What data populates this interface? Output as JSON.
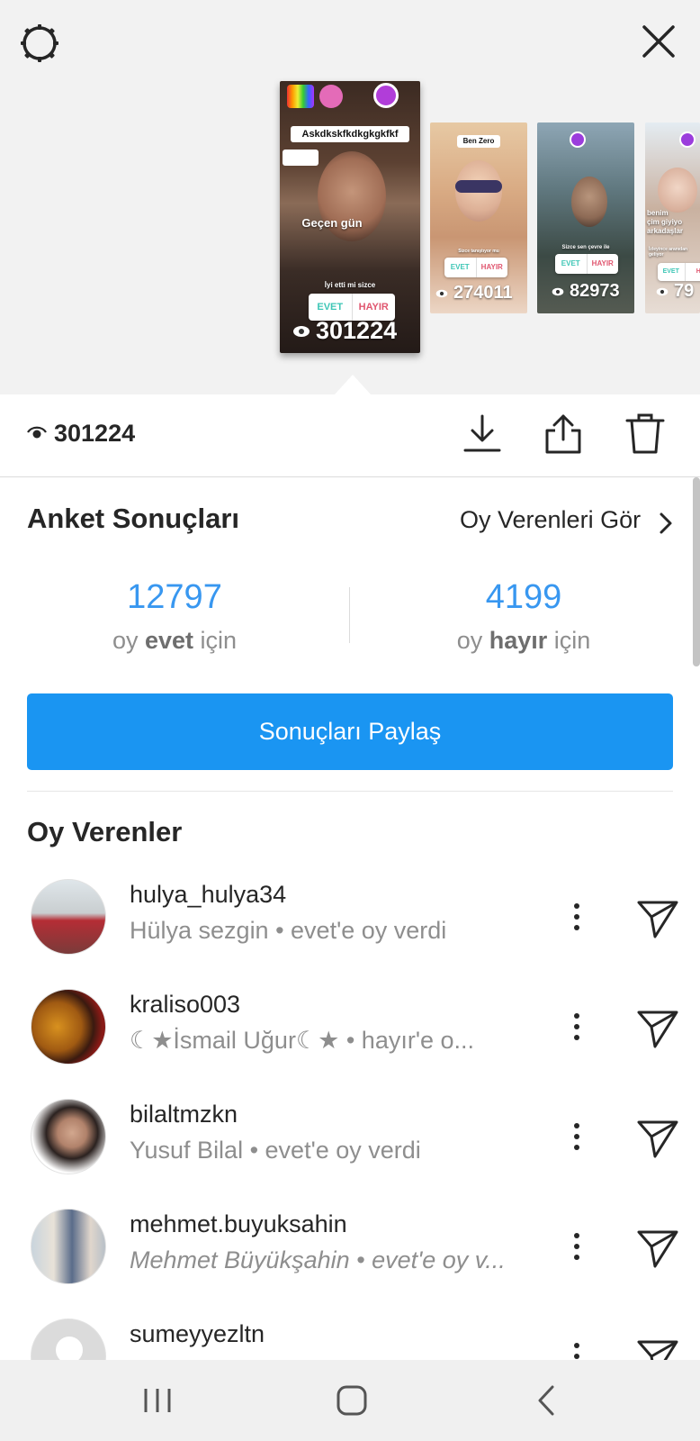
{
  "top": {
    "stories": [
      {
        "views": "301224",
        "caption_top": "Askdkskfkdkgkgkfkf",
        "text_mid": "Geçen gün",
        "question": "İyi etti mi sizce",
        "yes": "EVET",
        "no": "HAYIR"
      },
      {
        "views": "274011",
        "caption_top": "Ben Zero",
        "question": "Sizce tanıştıyor mu",
        "yes": "EVET",
        "no": "HAYIR"
      },
      {
        "views": "82973",
        "question": "Sizce sen çevre ile",
        "yes": "EVET",
        "no": "HAYIR"
      },
      {
        "views": "79",
        "text_mid": "benim\nçim giyiyo\narkadaşlar",
        "question": "İzleyince aranıdan\ngeliyor",
        "yes": "EVET",
        "no": "H"
      }
    ]
  },
  "views_bar": {
    "count": "301224"
  },
  "poll": {
    "title": "Anket Sonuçları",
    "see_voters": "Oy Verenleri Gör",
    "yes": {
      "count": "12797",
      "prefix": "oy ",
      "word": "evet",
      "suffix": " için"
    },
    "no": {
      "count": "4199",
      "prefix": "oy ",
      "word": "hayır",
      "suffix": " için"
    },
    "share": "Sonuçları Paylaş"
  },
  "voters": {
    "title": "Oy Verenler",
    "items": [
      {
        "username": "hulya_hulya34",
        "subtitle": "Hülya sezgin • evet'e oy verdi"
      },
      {
        "username": "kraliso003",
        "subtitle": "☾★İsmail Uğur☾★ • hayır'e o..."
      },
      {
        "username": "bilaltmzkn",
        "subtitle": "Yusuf Bilal • evet'e oy verdi"
      },
      {
        "username": "mehmet.buyuksahin",
        "subtitle": "Mehmet Büyükşahin • evet'e oy v..."
      },
      {
        "username": "sumeyyezltn",
        "subtitle": ""
      }
    ]
  },
  "colors": {
    "accent": "#1a95f2",
    "number": "#3897f0"
  }
}
